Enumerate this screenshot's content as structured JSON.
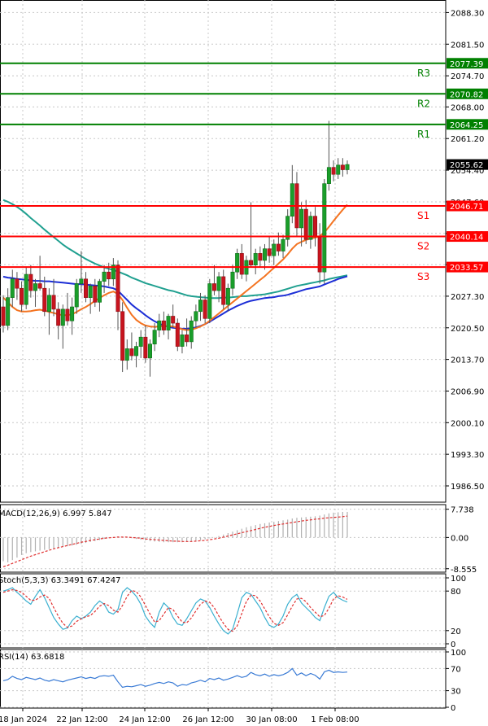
{
  "chart_data": [
    {
      "type": "candlestick",
      "instrument_note": "",
      "y_ticks": [
        "2088.30",
        "2081.50",
        "2074.70",
        "2068.00",
        "2061.20",
        "2054.40",
        "2047.60",
        "2040.80",
        "2034.10",
        "2027.30",
        "2020.50",
        "2013.70",
        "2006.90",
        "2000.10",
        "1993.30",
        "1986.50"
      ],
      "ylim": [
        1983.0,
        2091.0
      ],
      "x_ticks": [
        "18 Jan 2024",
        "22 Jan 12:00",
        "24 Jan 12:00",
        "26 Jan 12:00",
        "30 Jan 08:00",
        "1 Feb 08:00"
      ],
      "current_price": "2055.62",
      "levels": [
        {
          "name": "R3",
          "value": 2077.39,
          "label": "2077.39",
          "color": "#008000"
        },
        {
          "name": "R2",
          "value": 2070.82,
          "label": "2070.82",
          "color": "#008000"
        },
        {
          "name": "R1",
          "value": 2064.25,
          "label": "2064.25",
          "color": "#008000"
        },
        {
          "name": "S1",
          "value": 2046.71,
          "label": "2046.71",
          "color": "#ff0000"
        },
        {
          "name": "S2",
          "value": 2040.14,
          "label": "2040.14",
          "color": "#ff0000"
        },
        {
          "name": "S3",
          "value": 2033.57,
          "label": "2033.57",
          "color": "#ff0000"
        }
      ],
      "candles": [
        [
          2025.0,
          2027.5,
          2019.5,
          2021.0
        ],
        [
          2021.0,
          2029.0,
          2020.0,
          2027.0
        ],
        [
          2027.0,
          2033.0,
          2025.0,
          2031.0
        ],
        [
          2031.0,
          2032.5,
          2026.5,
          2029.0
        ],
        [
          2029.0,
          2030.5,
          2024.0,
          2025.5
        ],
        [
          2025.5,
          2033.5,
          2024.5,
          2032.0
        ],
        [
          2032.0,
          2034.0,
          2027.0,
          2028.5
        ],
        [
          2028.5,
          2031.0,
          2025.0,
          2030.0
        ],
        [
          2030.0,
          2036.0,
          2028.5,
          2029.0
        ],
        [
          2029.0,
          2031.5,
          2023.0,
          2024.0
        ],
        [
          2024.0,
          2029.0,
          2019.0,
          2027.5
        ],
        [
          2027.5,
          2031.0,
          2023.0,
          2024.5
        ],
        [
          2024.5,
          2026.0,
          2018.0,
          2021.0
        ],
        [
          2021.0,
          2025.5,
          2016.0,
          2024.5
        ],
        [
          2024.5,
          2028.0,
          2021.0,
          2022.0
        ],
        [
          2022.0,
          2027.0,
          2019.0,
          2025.0
        ],
        [
          2025.0,
          2031.0,
          2023.5,
          2030.0
        ],
        [
          2030.0,
          2037.0,
          2028.0,
          2031.0
        ],
        [
          2031.0,
          2032.5,
          2026.0,
          2027.0
        ],
        [
          2027.0,
          2030.0,
          2023.5,
          2029.5
        ],
        [
          2029.5,
          2031.0,
          2025.0,
          2026.0
        ],
        [
          2026.0,
          2031.0,
          2024.0,
          2030.5
        ],
        [
          2030.5,
          2034.0,
          2028.0,
          2032.5
        ],
        [
          2032.5,
          2034.5,
          2029.5,
          2031.0
        ],
        [
          2031.0,
          2035.5,
          2029.5,
          2034.0
        ],
        [
          2034.0,
          2035.0,
          2020.0,
          2024.0
        ],
        [
          2024.0,
          2026.0,
          2011.0,
          2013.5
        ],
        [
          2013.5,
          2018.0,
          2011.5,
          2016.0
        ],
        [
          2016.0,
          2019.5,
          2013.5,
          2014.5
        ],
        [
          2014.5,
          2017.5,
          2012.0,
          2016.5
        ],
        [
          2016.5,
          2020.0,
          2014.0,
          2018.5
        ],
        [
          2018.5,
          2021.0,
          2013.0,
          2014.0
        ],
        [
          2014.0,
          2018.0,
          2010.0,
          2017.0
        ],
        [
          2017.0,
          2021.5,
          2015.5,
          2020.0
        ],
        [
          2020.0,
          2023.5,
          2018.5,
          2022.0
        ],
        [
          2022.0,
          2024.0,
          2019.0,
          2020.0
        ],
        [
          2020.0,
          2023.5,
          2018.0,
          2023.0
        ],
        [
          2023.0,
          2025.5,
          2020.5,
          2021.5
        ],
        [
          2021.5,
          2022.5,
          2015.5,
          2016.5
        ],
        [
          2016.5,
          2020.0,
          2015.0,
          2019.0
        ],
        [
          2019.0,
          2022.5,
          2016.5,
          2017.5
        ],
        [
          2017.5,
          2023.0,
          2016.0,
          2022.0
        ],
        [
          2022.0,
          2025.5,
          2020.5,
          2024.0
        ],
        [
          2024.0,
          2028.0,
          2022.0,
          2026.5
        ],
        [
          2026.5,
          2027.5,
          2021.5,
          2022.5
        ],
        [
          2022.5,
          2031.0,
          2021.5,
          2030.0
        ],
        [
          2030.0,
          2034.0,
          2027.5,
          2028.5
        ],
        [
          2028.5,
          2032.5,
          2026.0,
          2031.5
        ],
        [
          2031.5,
          2033.0,
          2024.5,
          2025.5
        ],
        [
          2025.5,
          2030.0,
          2024.0,
          2029.0
        ],
        [
          2029.0,
          2034.0,
          2027.5,
          2032.5
        ],
        [
          2032.5,
          2037.5,
          2031.0,
          2036.5
        ],
        [
          2036.5,
          2038.5,
          2031.0,
          2032.0
        ],
        [
          2032.0,
          2036.0,
          2030.5,
          2035.0
        ],
        [
          2035.0,
          2047.5,
          2033.5,
          2034.0
        ],
        [
          2034.0,
          2037.5,
          2032.0,
          2036.5
        ],
        [
          2036.5,
          2038.0,
          2033.5,
          2035.0
        ],
        [
          2035.0,
          2038.5,
          2033.0,
          2037.5
        ],
        [
          2037.5,
          2040.0,
          2034.5,
          2036.0
        ],
        [
          2036.0,
          2039.5,
          2034.0,
          2038.5
        ],
        [
          2038.5,
          2041.0,
          2036.0,
          2037.0
        ],
        [
          2037.0,
          2040.5,
          2035.5,
          2039.5
        ],
        [
          2039.5,
          2046.0,
          2038.0,
          2044.5
        ],
        [
          2044.5,
          2055.5,
          2043.0,
          2051.5
        ],
        [
          2051.5,
          2054.0,
          2040.0,
          2042.0
        ],
        [
          2042.0,
          2047.5,
          2038.0,
          2046.0
        ],
        [
          2046.0,
          2048.0,
          2038.5,
          2039.5
        ],
        [
          2039.5,
          2045.5,
          2037.5,
          2044.5
        ],
        [
          2044.5,
          2046.5,
          2038.0,
          2040.0
        ],
        [
          2040.0,
          2043.0,
          2030.0,
          2032.5
        ],
        [
          2032.5,
          2052.5,
          2030.0,
          2051.5
        ],
        [
          2051.5,
          2065.0,
          2050.0,
          2055.0
        ],
        [
          2055.0,
          2056.5,
          2052.0,
          2053.5
        ],
        [
          2053.5,
          2057.0,
          2052.5,
          2055.5
        ],
        [
          2055.5,
          2057.0,
          2053.0,
          2054.5
        ],
        [
          2054.5,
          2056.5,
          2053.5,
          2055.62
        ]
      ],
      "series": [
        {
          "name": "",
          "color": "#20a090",
          "values": [
            2048.0,
            2047.6,
            2047.1,
            2046.5,
            2045.8,
            2045.0,
            2044.1,
            2043.3,
            2042.5,
            2041.6,
            2040.8,
            2040.0,
            2039.2,
            2038.4,
            2037.7,
            2037.1,
            2036.5,
            2035.9,
            2035.3,
            2034.8,
            2034.3,
            2033.9,
            2033.5,
            2033.2,
            2032.9,
            2032.6,
            2032.2,
            2031.8,
            2031.3,
            2030.9,
            2030.5,
            2030.1,
            2029.8,
            2029.5,
            2029.2,
            2028.9,
            2028.6,
            2028.4,
            2028.1,
            2027.8,
            2027.5,
            2027.3,
            2027.2,
            2027.1,
            2027.0,
            2026.9,
            2026.9,
            2026.9,
            2027.0,
            2027.0,
            2027.1,
            2027.2,
            2027.3,
            2027.3,
            2027.4,
            2027.5,
            2027.6,
            2027.7,
            2027.9,
            2028.1,
            2028.3,
            2028.6,
            2028.9,
            2029.2,
            2029.5,
            2029.7,
            2029.9,
            2030.1,
            2030.3,
            2030.5,
            2030.7,
            2031.0,
            2031.2,
            2031.4,
            2031.6,
            2031.8
          ]
        },
        {
          "name": "",
          "color": "#1c2ed6",
          "values": [
            2031.5,
            2031.3,
            2031.2,
            2031.0,
            2030.9,
            2030.8,
            2030.7,
            2030.6,
            2030.6,
            2030.5,
            2030.5,
            2030.4,
            2030.3,
            2030.2,
            2030.1,
            2030.0,
            2029.9,
            2029.9,
            2029.8,
            2029.7,
            2029.6,
            2029.5,
            2029.4,
            2029.2,
            2029.0,
            2028.5,
            2027.5,
            2026.5,
            2025.5,
            2024.7,
            2024.0,
            2023.2,
            2022.5,
            2021.9,
            2021.4,
            2021.0,
            2020.7,
            2020.5,
            2020.4,
            2020.3,
            2020.3,
            2020.4,
            2020.6,
            2020.9,
            2021.3,
            2021.8,
            2022.4,
            2023.0,
            2023.6,
            2024.2,
            2024.7,
            2025.2,
            2025.6,
            2026.0,
            2026.3,
            2026.5,
            2026.7,
            2026.9,
            2027.0,
            2027.1,
            2027.3,
            2027.4,
            2027.6,
            2027.9,
            2028.2,
            2028.5,
            2028.8,
            2029.0,
            2029.2,
            2029.4,
            2029.8,
            2030.2,
            2030.6,
            2031.0,
            2031.3,
            2031.6
          ]
        },
        {
          "name": "",
          "color": "#f47320",
          "values": [
            2027.0,
            2026.0,
            2025.0,
            2024.3,
            2024.0,
            2024.0,
            2024.1,
            2024.3,
            2024.4,
            2024.2,
            2023.9,
            2023.7,
            2023.4,
            2023.2,
            2023.2,
            2023.4,
            2023.9,
            2024.5,
            2025.0,
            2025.6,
            2026.3,
            2026.9,
            2027.5,
            2028.0,
            2028.3,
            2027.8,
            2026.5,
            2024.8,
            2023.3,
            2022.2,
            2021.5,
            2021.0,
            2020.8,
            2020.7,
            2020.8,
            2020.9,
            2020.9,
            2020.8,
            2020.5,
            2020.2,
            2020.0,
            2020.1,
            2020.4,
            2020.8,
            2021.3,
            2022.0,
            2022.8,
            2023.6,
            2024.4,
            2025.2,
            2026.0,
            2026.8,
            2027.6,
            2028.4,
            2029.2,
            2030.0,
            2030.8,
            2031.6,
            2032.5,
            2033.4,
            2034.3,
            2035.2,
            2036.3,
            2037.5,
            2038.5,
            2039.0,
            2039.4,
            2039.7,
            2039.9,
            2040.2,
            2041.0,
            2042.2,
            2043.5,
            2044.7,
            2045.9,
            2047.0
          ]
        }
      ]
    },
    {
      "type": "macd",
      "label": "MACD(12,26,9) 6.997 5.847",
      "y_ticks": [
        "7.738",
        "0.00",
        "-8.555"
      ],
      "ylim": [
        -9.5,
        9.0
      ],
      "histogram": [
        -6.5,
        -6.8,
        -6.2,
        -5.5,
        -4.8,
        -4.3,
        -4.0,
        -3.8,
        -3.6,
        -3.4,
        -3.2,
        -3.0,
        -2.8,
        -2.6,
        -2.4,
        -2.2,
        -2.0,
        -1.8,
        -1.5,
        -1.2,
        -1.0,
        -0.7,
        -0.4,
        -0.1,
        0.1,
        0.3,
        0.2,
        0.0,
        -0.2,
        -0.4,
        -0.6,
        -0.8,
        -1.0,
        -1.1,
        -1.2,
        -1.3,
        -1.3,
        -1.3,
        -1.3,
        -1.3,
        -1.2,
        -1.1,
        -0.9,
        -0.7,
        -0.5,
        -0.2,
        0.1,
        0.4,
        0.8,
        1.2,
        1.6,
        2.0,
        2.4,
        2.8,
        3.1,
        3.4,
        3.7,
        3.9,
        4.1,
        4.3,
        4.5,
        4.7,
        4.9,
        5.2,
        5.4,
        5.5,
        5.6,
        5.7,
        5.8,
        6.0,
        6.3,
        6.6,
        6.8,
        6.9,
        7.0,
        7.0
      ],
      "signal": [
        -8.0,
        -7.6,
        -7.1,
        -6.6,
        -6.1,
        -5.6,
        -5.1,
        -4.7,
        -4.3,
        -3.9,
        -3.5,
        -3.1,
        -2.8,
        -2.5,
        -2.2,
        -1.9,
        -1.6,
        -1.3,
        -1.1,
        -0.8,
        -0.6,
        -0.4,
        -0.2,
        -0.1,
        0.0,
        0.1,
        0.1,
        0.1,
        0.0,
        -0.1,
        -0.2,
        -0.4,
        -0.5,
        -0.6,
        -0.7,
        -0.8,
        -0.9,
        -1.0,
        -1.0,
        -1.1,
        -1.1,
        -1.1,
        -1.0,
        -0.9,
        -0.8,
        -0.6,
        -0.4,
        -0.2,
        0.1,
        0.4,
        0.7,
        1.0,
        1.3,
        1.6,
        1.9,
        2.2,
        2.5,
        2.8,
        3.0,
        3.3,
        3.5,
        3.7,
        3.9,
        4.1,
        4.3,
        4.5,
        4.7,
        4.8,
        5.0,
        5.1,
        5.3,
        5.4,
        5.5,
        5.6,
        5.7,
        5.85
      ]
    },
    {
      "type": "stochastic",
      "label": "Stoch(5,3,3) 63.3491 67.4247",
      "y_ticks": [
        "100",
        "80",
        "20",
        "0"
      ],
      "ylim": [
        0,
        100
      ],
      "k": [
        80,
        82,
        85,
        78,
        72,
        65,
        60,
        72,
        82,
        70,
        55,
        40,
        30,
        22,
        24,
        35,
        42,
        38,
        42,
        48,
        58,
        65,
        60,
        48,
        45,
        52,
        78,
        85,
        80,
        72,
        60,
        42,
        32,
        25,
        48,
        62,
        55,
        40,
        30,
        28,
        38,
        50,
        62,
        68,
        65,
        55,
        42,
        30,
        20,
        15,
        22,
        45,
        70,
        78,
        75,
        65,
        55,
        40,
        28,
        25,
        30,
        42,
        60,
        70,
        75,
        62,
        55,
        48,
        40,
        35,
        55,
        72,
        78,
        70,
        66,
        63.35
      ],
      "d": [
        78,
        80,
        82,
        81,
        78,
        72,
        66,
        66,
        71,
        74,
        69,
        55,
        42,
        31,
        25,
        27,
        34,
        38,
        41,
        43,
        49,
        57,
        61,
        58,
        51,
        48,
        58,
        72,
        81,
        79,
        71,
        58,
        45,
        33,
        35,
        45,
        55,
        52,
        42,
        33,
        32,
        39,
        50,
        60,
        65,
        63,
        55,
        42,
        31,
        22,
        19,
        27,
        46,
        64,
        74,
        73,
        65,
        53,
        41,
        31,
        28,
        32,
        44,
        57,
        68,
        69,
        64,
        55,
        48,
        41,
        43,
        54,
        68,
        73,
        71,
        67.42
      ]
    },
    {
      "type": "rsi",
      "label": "RSI(14) 63.6818",
      "y_ticks": [
        "100",
        "70",
        "30",
        "0"
      ],
      "ylim": [
        0,
        100
      ],
      "values": [
        48,
        50,
        56,
        52,
        50,
        54,
        52,
        50,
        53,
        49,
        47,
        50,
        48,
        46,
        49,
        51,
        53,
        55,
        52,
        54,
        52,
        56,
        57,
        56,
        58,
        46,
        36,
        38,
        37,
        39,
        41,
        38,
        40,
        43,
        45,
        43,
        46,
        44,
        38,
        41,
        40,
        44,
        46,
        49,
        46,
        52,
        50,
        53,
        49,
        51,
        54,
        57,
        54,
        56,
        63,
        59,
        57,
        60,
        56,
        59,
        57,
        59,
        63,
        70,
        58,
        62,
        57,
        61,
        58,
        51,
        64,
        67,
        63,
        64,
        63,
        63.68
      ]
    }
  ]
}
